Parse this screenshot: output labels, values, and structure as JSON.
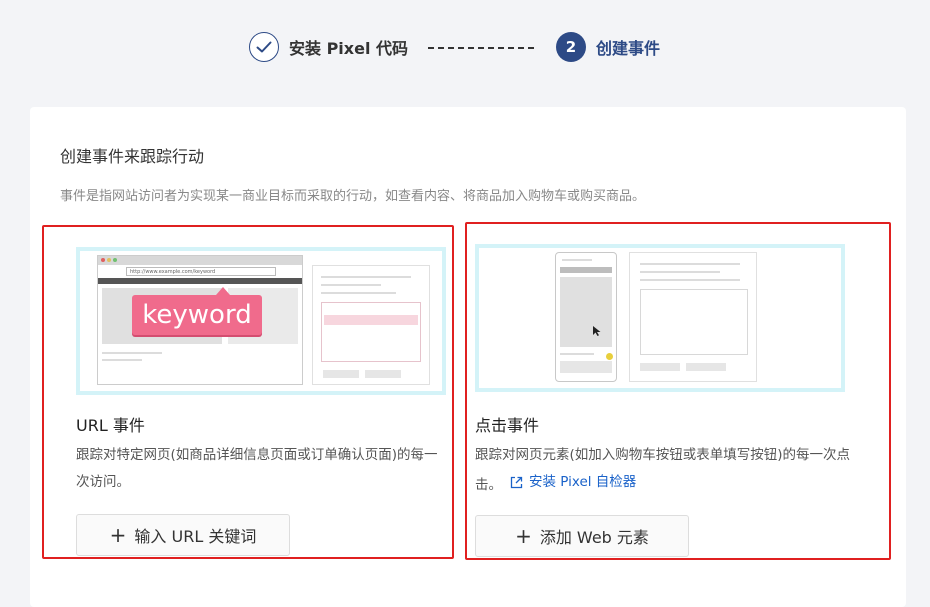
{
  "stepper": {
    "step1": {
      "label": "安装 Pixel 代码"
    },
    "step2": {
      "number": "2",
      "label": "创建事件"
    }
  },
  "card": {
    "title": "创建事件来跟踪行动",
    "description": "事件是指网站访问者为实现某一商业目标而采取的行动，如查看内容、将商品加入购物车或购买商品。"
  },
  "url_event": {
    "title": "URL 事件",
    "description": "跟踪对特定网页(如商品详细信息页面或订单确认页面)的每一次访问。",
    "button_label": "输入 URL 关键词",
    "illustration": {
      "url_text": "http://www.example.com/keyword",
      "keyword": "keyword"
    }
  },
  "click_event": {
    "title": "点击事件",
    "description": "跟踪对网页元素(如加入购物车按钮或表单填写按钮)的每一次点击。",
    "link_label": "安装 Pixel 自检器",
    "button_label": "添加 Web 元素"
  },
  "colors": {
    "primary": "#2d4a86",
    "highlight_border": "#e02020",
    "link": "#1a62c9",
    "keyword_tag": "#f06b8c"
  },
  "icons": {
    "step1": "check-icon",
    "link": "external-link-icon",
    "button": "plus-icon"
  }
}
